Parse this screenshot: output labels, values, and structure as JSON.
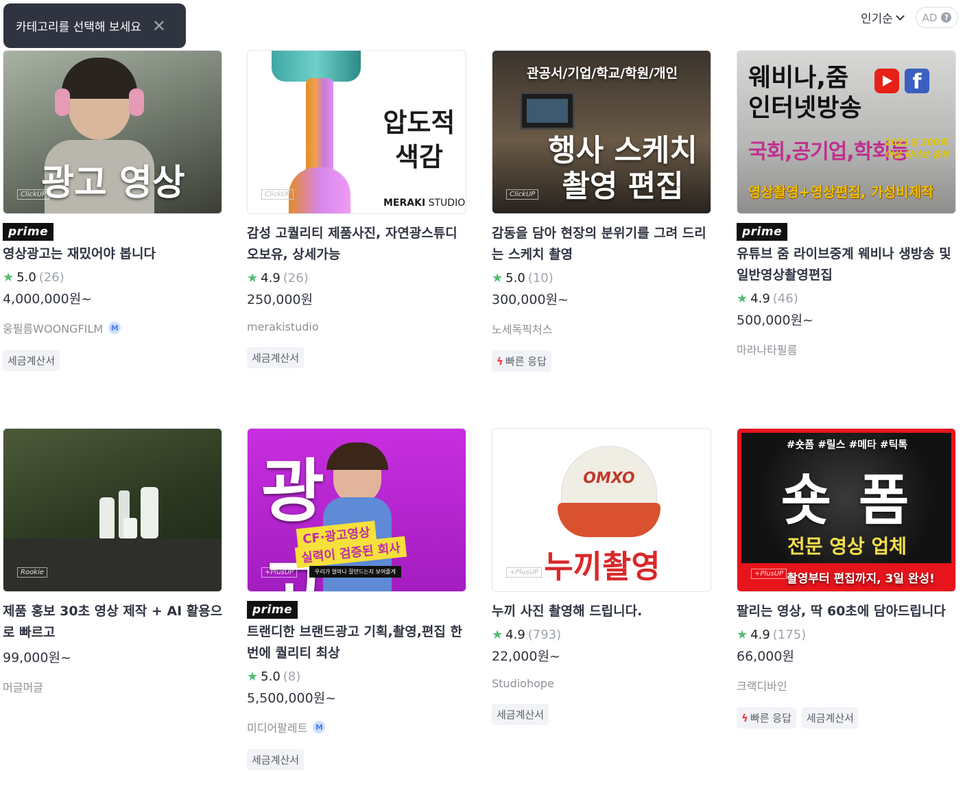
{
  "tooltip": {
    "text": "카테고리를 선택해 보세요",
    "close": "✕"
  },
  "sort": {
    "label": "인기순"
  },
  "ad": {
    "label": "AD",
    "help": "?"
  },
  "cards": [
    {
      "thumb": {
        "overlay_main": "광고 영상",
        "corner": "ClickUP"
      },
      "prime": "prime",
      "title": "영상광고는 재밌어야 봅니다",
      "rating": "5.0",
      "reviews": "(26)",
      "price": "4,000,000원~",
      "seller": "웅필름WOONGFILM",
      "seller_badge": "M",
      "tags": [
        "세금계산서"
      ]
    },
    {
      "thumb": {
        "overlay_main": "압도적\n색감",
        "brand_bold": "MERAKI",
        "brand_light": " STUDIO",
        "corner": "ClickUP"
      },
      "title": "감성 고퀄리티 제품사진, 자연광스튜디오보유, 상세가능",
      "rating": "4.9",
      "reviews": "(26)",
      "price": "250,000원",
      "seller": "merakistudio",
      "tags": [
        "세금계산서"
      ]
    },
    {
      "thumb": {
        "overlay_top": "관공서/기업/학교/학원/개인",
        "overlay_main": "행사 스케치\n촬영 편집",
        "corner": "ClickUP"
      },
      "title": "감동을 담아 현장의 분위기를 그려 드리는 스케치 촬영",
      "rating": "5.0",
      "reviews": "(10)",
      "price": "300,000원~",
      "seller": "노세독픽처스",
      "tags": [
        "빠른 응답"
      ]
    },
    {
      "thumb": {
        "overlay_top": "웨비나,줌\n인터넷방송",
        "overlay_mid": "국회,공기업,학회등",
        "overlay_side": "2021년 200회\n이상 라이브 중계",
        "overlay_bottom": "영상촬영+영상편집, 가성비제작"
      },
      "prime": "prime",
      "title": "유튜브 줌 라이브중계 웨비나 생방송 및 일반영상촬영편집",
      "rating": "4.9",
      "reviews": "(46)",
      "price": "500,000원~",
      "seller": "마라나타필름",
      "tags": []
    },
    {
      "thumb": {
        "corner": "Rookie"
      },
      "title": "제품 홍보 30초 영상 제작 + AI 활용으로 빠르고",
      "price": "99,000원~",
      "seller": "머글머글",
      "tags": []
    },
    {
      "thumb": {
        "overlay_main": "광고",
        "overlay_sub1": "CF·광고영상",
        "overlay_sub2": "실력이 검증된 회사",
        "overlay_small": "우리가 얼마나 잘만드는지 보여줄게",
        "corner": "+PlusUP"
      },
      "prime": "prime",
      "title": "트랜디한 브랜드광고 기획,촬영,편집 한번에 퀄리티 최상",
      "rating": "5.0",
      "reviews": "(8)",
      "price": "5,500,000원~",
      "seller": "미디어팔레트",
      "seller_badge": "M",
      "tags": [
        "세금계산서"
      ]
    },
    {
      "thumb": {
        "overlay_main": "누끼촬영",
        "cap_text": "OMXO",
        "corner": "+PlusUP"
      },
      "title": "누끼 사진 촬영해 드립니다.",
      "rating": "4.9",
      "reviews": "(793)",
      "price": "22,000원~",
      "seller": "Studiohope",
      "tags": [
        "세금계산서"
      ]
    },
    {
      "thumb": {
        "overlay_top": "#숏폼  #릴스  #메타  #틱톡",
        "overlay_main": "숏 폼",
        "overlay_sub": "전문 영상 업체",
        "overlay_bottom": "촬영부터 편집까지, 3일 완성!",
        "corner": "+PlusUP"
      },
      "title": "팔리는 영상, 딱 60초에 담아드립니다",
      "rating": "4.9",
      "reviews": "(175)",
      "price": "66,000원",
      "seller": "크랙디바인",
      "tags": [
        "빠른 응답",
        "세금계산서"
      ]
    }
  ],
  "colors": {
    "star": "#4fbd6e",
    "bolt": "#f43b3b",
    "tooltip_bg": "#303441",
    "accent_red": "#e8141c"
  },
  "icons": {
    "star": "star-icon",
    "bolt": "lightning-icon",
    "close": "close-icon",
    "chevron": "chevron-down-icon"
  }
}
